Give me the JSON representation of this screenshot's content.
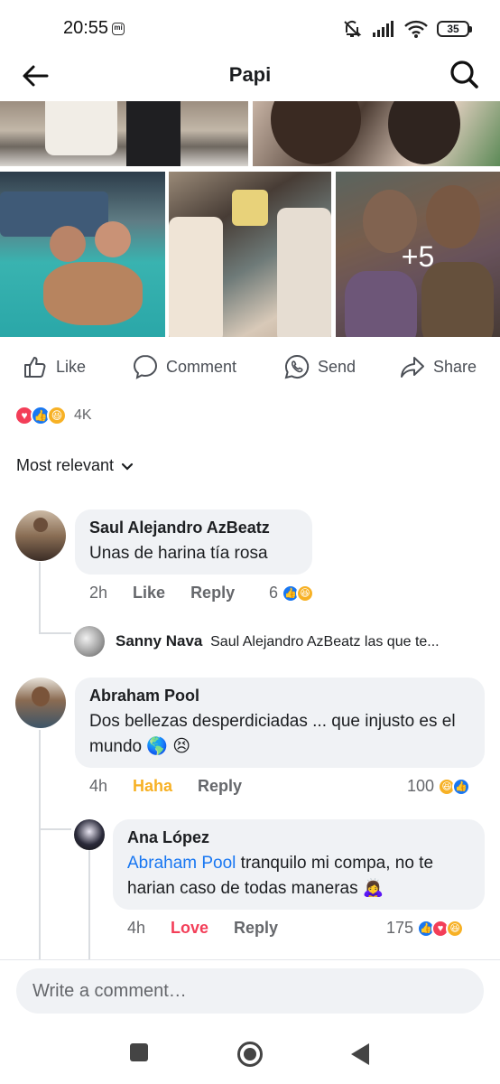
{
  "status_bar": {
    "time": "20:55",
    "battery": "35"
  },
  "header": {
    "title": "Papi"
  },
  "photos": {
    "more_count": "+5"
  },
  "actions": {
    "like": "Like",
    "comment": "Comment",
    "send": "Send",
    "share": "Share"
  },
  "reactions": {
    "count": "4K",
    "types": [
      "love",
      "like",
      "haha"
    ]
  },
  "sort": {
    "label": "Most relevant"
  },
  "comments": [
    {
      "author": "Saul Alejandro AzBeatz",
      "text": "Unas de harina tía rosa",
      "time": "2h",
      "like_label": "Like",
      "reply_label": "Reply",
      "reaction_count": "6",
      "reply_preview": {
        "author": "Sanny Nava",
        "text": "Saul Alejandro AzBeatz las que te..."
      }
    },
    {
      "author": "Abraham Pool",
      "text": "Dos bellezas desperdiciadas ... que injusto es el mundo 🌎 😣",
      "time": "4h",
      "like_label": "Haha",
      "reply_label": "Reply",
      "reaction_count": "100",
      "replies": [
        {
          "author": "Ana López",
          "mention": "Abraham Pool",
          "text": " tranquilo mi compa, no te harian caso de todas maneras 🙇‍♀️",
          "time": "4h",
          "like_label": "Love",
          "reply_label": "Reply",
          "reaction_count": "175"
        }
      ]
    }
  ],
  "composer": {
    "placeholder": "Write a comment…"
  },
  "colors": {
    "accent": "#1877f2",
    "haha": "#f7b125",
    "love": "#f33e58",
    "bubble": "#f0f2f5"
  }
}
